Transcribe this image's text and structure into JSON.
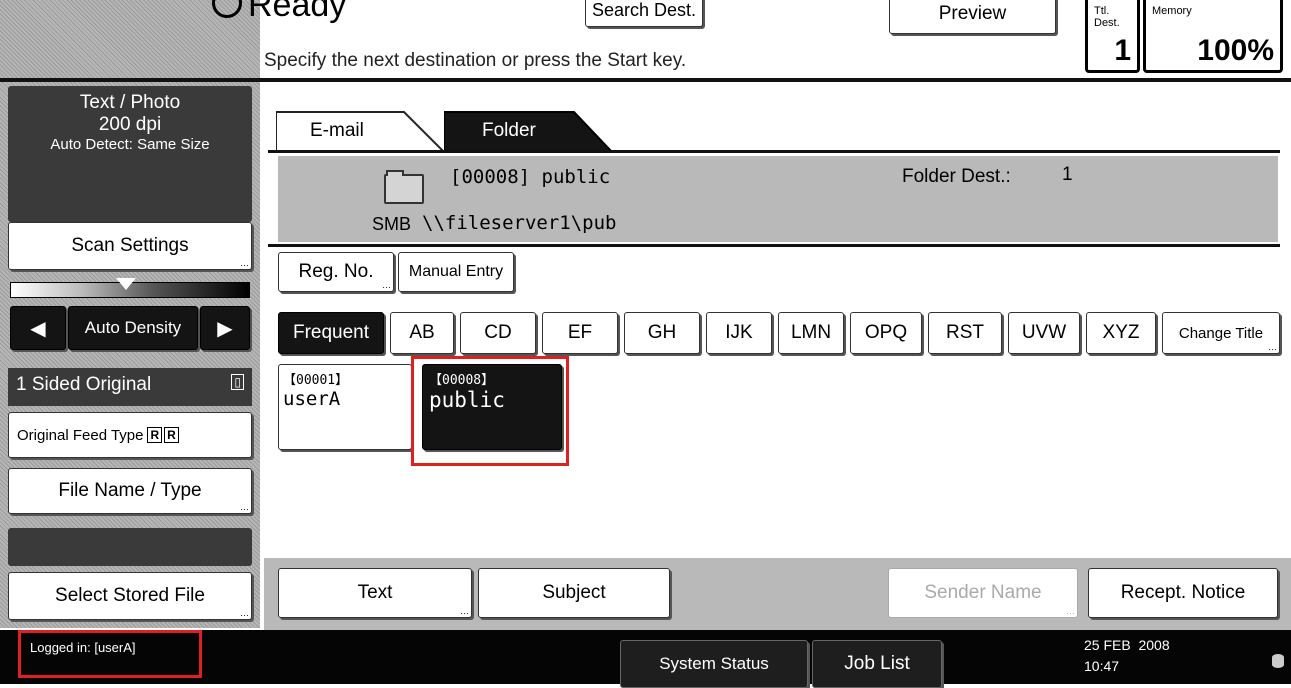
{
  "header": {
    "status": "Ready",
    "message": "Specify the next destination or press the Start key.",
    "search_dest": "Search Dest.",
    "preview": "Preview",
    "ttl_dest_label": "Ttl. Dest.",
    "ttl_dest_value": "1",
    "memory_label": "Memory",
    "memory_value": "100%"
  },
  "sidebar": {
    "scan_mode": "Text / Photo",
    "resolution": "200 dpi",
    "detect": "Auto Detect: Same Size",
    "scan_settings": "Scan Settings",
    "auto_density": "Auto Density",
    "sided_original": "1 Sided Original",
    "original_feed_type": "Original Feed Type",
    "file_name_type": "File Name / Type",
    "select_stored_file": "Select Stored File"
  },
  "tabs": [
    {
      "label": "E-mail",
      "active": false
    },
    {
      "label": "Folder",
      "active": true
    }
  ],
  "destination": {
    "code": "[00008] public",
    "protocol": "SMB",
    "path": "\\\\fileserver1\\pub",
    "folder_dest_label": "Folder Dest.:",
    "folder_dest_value": "1"
  },
  "toolbar": {
    "reg_no": "Reg. No.",
    "manual_entry": "Manual Entry"
  },
  "index_tabs": [
    "Frequent",
    "AB",
    "CD",
    "EF",
    "GH",
    "IJK",
    "LMN",
    "OPQ",
    "RST",
    "UVW",
    "XYZ"
  ],
  "change_title": "Change Title",
  "entries": [
    {
      "code": "【00001】",
      "name": "userA",
      "selected": false
    },
    {
      "code": "【00008】",
      "name": "public",
      "selected": true
    }
  ],
  "bottom": {
    "text": "Text",
    "subject": "Subject",
    "sender_name": "Sender Name",
    "recept_notice": "Recept. Notice"
  },
  "statusbar": {
    "logged_in": "Logged in: [userA]",
    "system_status": "System Status",
    "job_list": "Job List",
    "date": "25 FEB  2008",
    "time": "10:47"
  },
  "colors": {
    "highlight": "#e02020",
    "dark": "#141414",
    "panel_gray": "#b9b9b9"
  }
}
